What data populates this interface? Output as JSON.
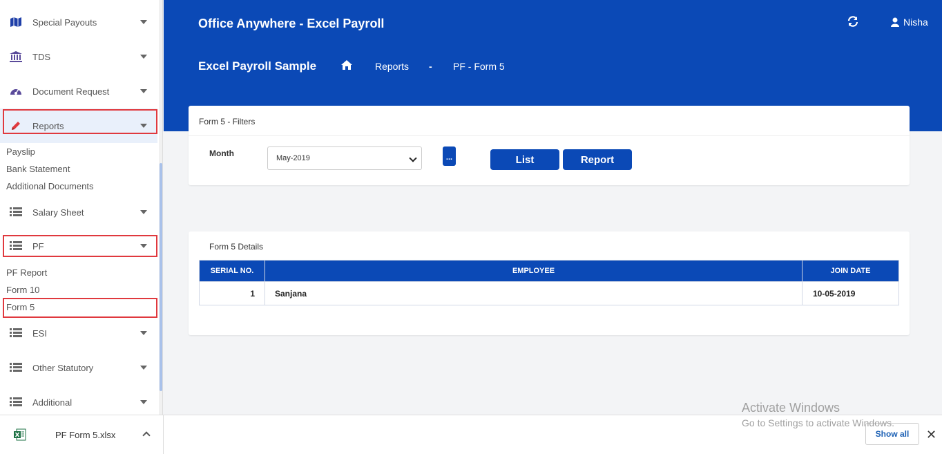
{
  "sidebar": {
    "items": [
      {
        "label": "Special Payouts",
        "icon": "map-icon"
      },
      {
        "label": "TDS",
        "icon": "bank-icon"
      },
      {
        "label": "Document Request",
        "icon": "dashboard-icon"
      },
      {
        "label": "Reports",
        "icon": "pencil-icon"
      },
      {
        "label": "Salary Sheet",
        "icon": "list-icon"
      },
      {
        "label": "PF",
        "icon": "list-icon"
      },
      {
        "label": "ESI",
        "icon": "list-icon"
      },
      {
        "label": "Other Statutory",
        "icon": "list-icon"
      },
      {
        "label": "Additional",
        "icon": "list-icon"
      }
    ],
    "reports_sub": [
      "Payslip",
      "Bank Statement",
      "Additional Documents"
    ],
    "pf_sub": [
      "PF Report",
      "Form 10",
      "Form 5"
    ]
  },
  "header": {
    "app_title": "Office Anywhere - Excel Payroll",
    "user_name": "Nisha",
    "subtitle": "Excel Payroll Sample",
    "breadcrumb": {
      "reports": "Reports",
      "separator": "-",
      "current": "PF - Form 5"
    }
  },
  "filters": {
    "title": "Form 5 - Filters",
    "month_label": "Month",
    "month_value": "May-2019",
    "dots_label": "...",
    "list_button": "List",
    "report_button": "Report"
  },
  "details": {
    "title": "Form 5 Details",
    "columns": [
      "SERIAL NO.",
      "EMPLOYEE",
      "JOIN DATE"
    ],
    "rows": [
      {
        "serial": "1",
        "employee": "Sanjana",
        "join_date": "10-05-2019"
      }
    ]
  },
  "downloads": {
    "file_name": "PF Form 5.xlsx",
    "show_all": "Show all",
    "close": "✕"
  },
  "watermark": {
    "line1": "Activate Windows",
    "line2": "Go to Settings to activate Windows."
  },
  "colors": {
    "brand": "#0b49b6",
    "highlight": "#e0393e"
  }
}
